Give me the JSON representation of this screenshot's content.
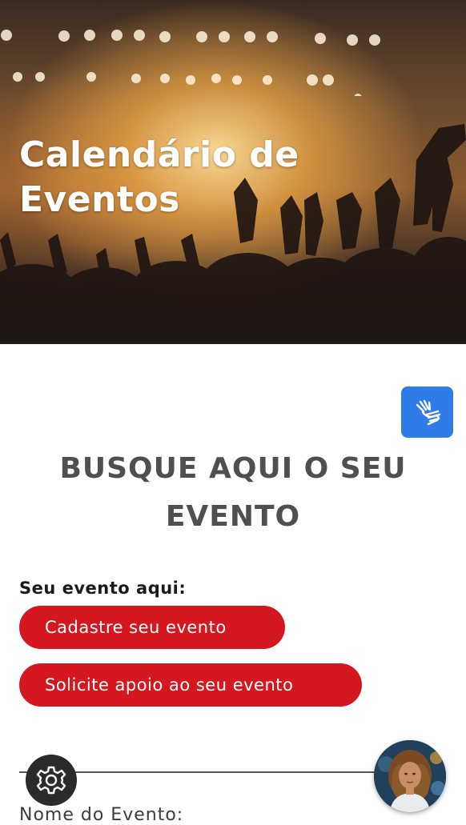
{
  "hero": {
    "title_line1": "Calendário de",
    "title_line2": "Eventos",
    "image": "concert-crowd-photo"
  },
  "accessibility": {
    "icon": "sign-language-hands-icon",
    "color": "#2f7ce8"
  },
  "search": {
    "heading_line1": "BUSQUE AQUI O SEU",
    "heading_line2": "EVENTO"
  },
  "your_event": {
    "label": "Seu evento aqui:",
    "register_button": "Cadastre seu evento",
    "support_button": "Solicite apoio ao seu evento",
    "button_color": "#d5171f"
  },
  "form": {
    "event_name_label": "Nome do Evento:"
  },
  "floating": {
    "settings_icon": "gear-icon",
    "assistant_icon": "assistant-avatar"
  }
}
